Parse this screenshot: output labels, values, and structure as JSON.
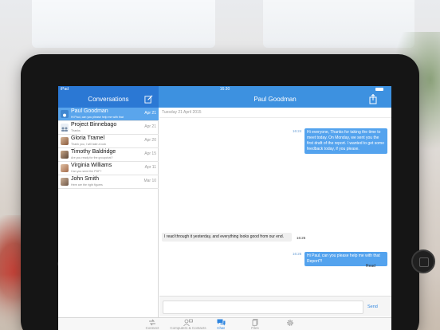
{
  "status_bar": {
    "carrier": "iPad",
    "time": "16:30"
  },
  "left_nav": {
    "title": "Conversations"
  },
  "right_nav": {
    "title": "Paul Goodman"
  },
  "conversations": [
    {
      "name": "Paul Goodman",
      "preview": "Hi Paul, can you please help me with that",
      "date": "Apr 21",
      "active": true,
      "avatar": "person-icon"
    },
    {
      "name": "Project Binnebago",
      "preview": "Thanks",
      "date": "Apr 21",
      "active": false,
      "avatar": "group-icon"
    },
    {
      "name": "Gloria Tramel",
      "preview": "Thank you, I will take a look",
      "date": "Apr 20",
      "active": false,
      "avatar": "photo"
    },
    {
      "name": "Timothy Baldridge",
      "preview": "Are you ready for the groupchat?",
      "date": "Apr 15",
      "active": false,
      "avatar": "photo"
    },
    {
      "name": "Virginia Williams",
      "preview": "Can you send the PDF?",
      "date": "Apr 11",
      "active": false,
      "avatar": "photo"
    },
    {
      "name": "John Smith",
      "preview": "Here are the right figures",
      "date": "Mar 10",
      "active": false,
      "avatar": "photo"
    }
  ],
  "chat": {
    "date_separator": "Tuesday 21 April 2015",
    "messages": [
      {
        "direction": "out",
        "time": "16:24",
        "text": "Hi everyone, Thanks for taking the time to meet today. On Monday, we sent you the first draft of the report. I wanted to get some feedback today, if you please."
      },
      {
        "direction": "in",
        "time": "16:25",
        "text": "I read through it yesterday, and everything looks good from our end."
      },
      {
        "direction": "out",
        "time": "16:26",
        "text": "Hi Paul, can you please help me with that Report?!"
      }
    ],
    "read_label": "Read",
    "composer_placeholder": "",
    "send_label": "Send"
  },
  "tabs": [
    {
      "label": "Connect",
      "icon": "connect-icon",
      "active": false
    },
    {
      "label": "Computers & Contacts",
      "icon": "contacts-icon",
      "active": false
    },
    {
      "label": "Chat",
      "icon": "chat-icon",
      "active": true
    },
    {
      "label": "Files",
      "icon": "files-icon",
      "active": false
    },
    {
      "label": "",
      "icon": "gear-icon",
      "active": false
    }
  ],
  "colors": {
    "accent": "#3d91e0",
    "sidebar_header": "#2b78d4",
    "outgoing_bubble": "#54a3ee",
    "incoming_bubble": "#efefef"
  }
}
